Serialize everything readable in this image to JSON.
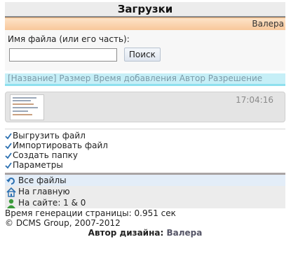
{
  "header": {
    "title": "Загрузки"
  },
  "user": {
    "name": "Валера"
  },
  "search": {
    "label": "Имя файла (или его часть):",
    "value": "",
    "placeholder": "",
    "button": "Поиск"
  },
  "sort": {
    "text": "[Название] Размер Время добавления Автор Разрешение"
  },
  "file": {
    "time": "17:04:16"
  },
  "actions": [
    "Выгрузить файл",
    "Импортировать файл",
    "Создать папку",
    "Параметры"
  ],
  "nav": {
    "all_files": "Все файлы",
    "home": "На главную",
    "online": "На сайте: 1 & 0"
  },
  "footer": {
    "gen_time": "Время генерации страницы: 0.951 сек",
    "copyright": "© DCMS Group, 2007-2012",
    "author_label": "Автор дизайна:",
    "author_name": "Валера"
  },
  "colors": {
    "accent": "#f8c79a",
    "sort_bg": "#c6eff7",
    "sort_text": "#7c9aa8"
  }
}
